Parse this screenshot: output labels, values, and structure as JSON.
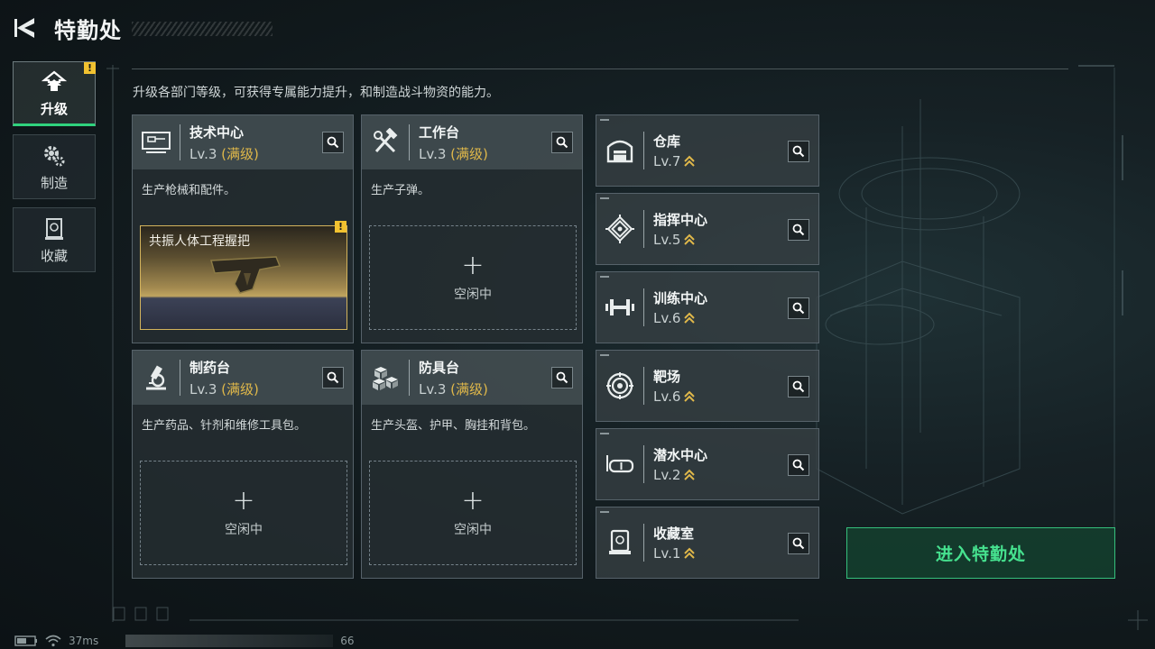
{
  "header": {
    "title": "特勤处"
  },
  "sidebar": {
    "tabs": [
      {
        "label": "升级",
        "icon": "upgrade-icon",
        "active": true,
        "badge": "!"
      },
      {
        "label": "制造",
        "icon": "gear-icon",
        "active": false
      },
      {
        "label": "收藏",
        "icon": "collection-icon",
        "active": false
      }
    ]
  },
  "description": "升级各部门等级，可获得专属能力提升，和制造战斗物资的能力。",
  "departments": [
    {
      "name": "技术中心",
      "level": "Lv.3",
      "max_tag": "(满级)",
      "desc": "生产枪械和配件。",
      "icon": "tech-terminal-icon",
      "slot": {
        "type": "item",
        "item_name": "共振人体工程握把",
        "badge": "!"
      }
    },
    {
      "name": "工作台",
      "level": "Lv.3",
      "max_tag": "(满级)",
      "desc": "生产子弹。",
      "icon": "hammer-wrench-icon",
      "slot": {
        "type": "empty",
        "label": "空闲中"
      }
    },
    {
      "name": "制药台",
      "level": "Lv.3",
      "max_tag": "(满级)",
      "desc": "生产药品、针剂和维修工具包。",
      "icon": "microscope-icon",
      "slot": {
        "type": "empty",
        "label": "空闲中"
      }
    },
    {
      "name": "防具台",
      "level": "Lv.3",
      "max_tag": "(满级)",
      "desc": "生产头盔、护甲、胸挂和背包。",
      "icon": "cubes-icon",
      "slot": {
        "type": "empty",
        "label": "空闲中"
      }
    }
  ],
  "facilities": [
    {
      "name": "仓库",
      "level": "Lv.7",
      "icon": "warehouse-icon"
    },
    {
      "name": "指挥中心",
      "level": "Lv.5",
      "icon": "chip-icon"
    },
    {
      "name": "训练中心",
      "level": "Lv.6",
      "icon": "dumbbell-icon"
    },
    {
      "name": "靶场",
      "level": "Lv.6",
      "icon": "target-icon"
    },
    {
      "name": "潜水中心",
      "level": "Lv.2",
      "icon": "diving-mask-icon"
    },
    {
      "name": "收藏室",
      "level": "Lv.1",
      "icon": "display-case-icon"
    }
  ],
  "enter_button": "进入特勤处",
  "status": {
    "ping": "37ms",
    "fps": "66"
  },
  "colors": {
    "accent_green": "#35c07c",
    "max_gold": "#e0b84a",
    "warn_yellow": "#f2c230"
  }
}
